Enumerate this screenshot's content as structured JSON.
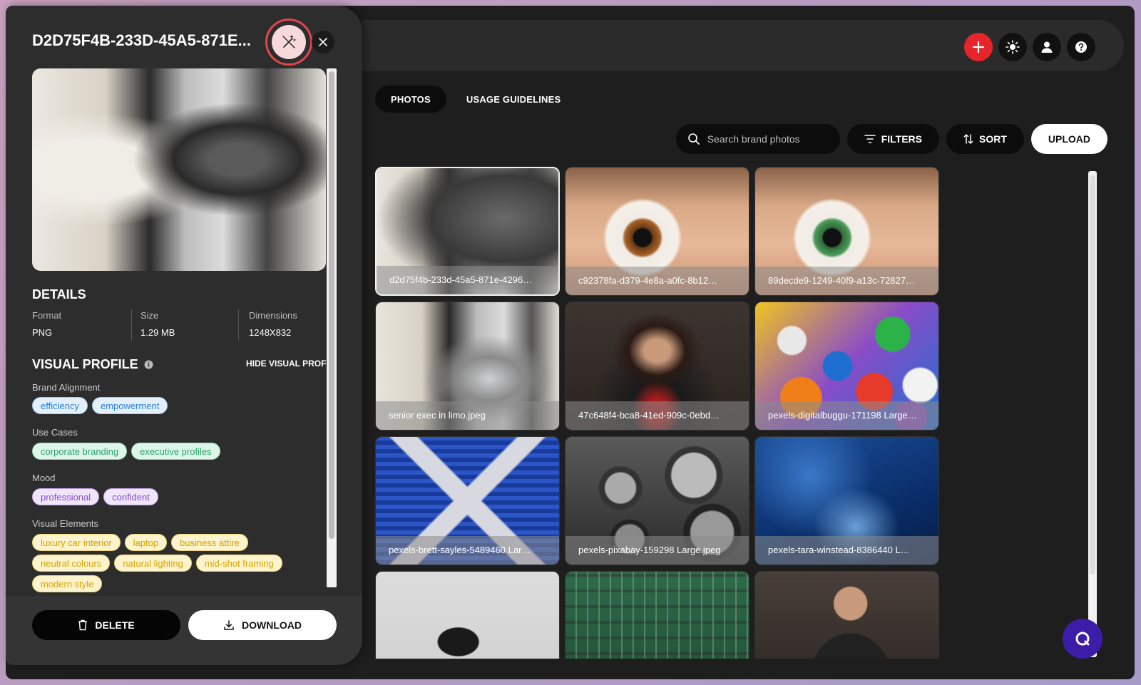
{
  "header": {
    "icons": [
      {
        "name": "add",
        "color": "#e5252a"
      },
      {
        "name": "theme-sun"
      },
      {
        "name": "user"
      },
      {
        "name": "help"
      }
    ]
  },
  "tabs": [
    {
      "label": "PHOTOS",
      "active": true
    },
    {
      "label": "USAGE GUIDELINES",
      "active": false
    }
  ],
  "toolbar": {
    "search_placeholder": "Search brand photos",
    "filters_label": "FILTERS",
    "sort_label": "SORT",
    "upload_label": "UPLOAD"
  },
  "photos": [
    {
      "name": "d2d75f4b-233d-45a5-871e-4296…",
      "selected": true
    },
    {
      "name": "c92378fa-d379-4e8a-a0fc-8b12…"
    },
    {
      "name": "89decde9-1249-40f9-a13c-72827…"
    },
    {
      "name": "senior exec in limo.jpeg"
    },
    {
      "name": "47c648f4-bca8-41ed-909c-0ebd…"
    },
    {
      "name": "pexels-digitalbuggu-171198 Large…"
    },
    {
      "name": "pexels-brett-sayles-5489460 Lar…"
    },
    {
      "name": "pexels-pixabay-159298 Large.jpeg"
    },
    {
      "name": "pexels-tara-winstead-8386440 L…"
    },
    {
      "name": ""
    },
    {
      "name": ""
    },
    {
      "name": ""
    }
  ],
  "panel": {
    "title": "D2D75F4B-233D-45A5-871E...",
    "details_heading": "DETAILS",
    "details": [
      {
        "label": "Format",
        "value": "PNG"
      },
      {
        "label": "Size",
        "value": "1.29 MB"
      },
      {
        "label": "Dimensions",
        "value": "1248X832"
      }
    ],
    "visual_profile_heading": "VISUAL PROFILE",
    "hide_visual_profile": "HIDE VISUAL PROFILE",
    "groups": [
      {
        "label": "Brand Alignment",
        "color": "blue",
        "tags": [
          "efficiency",
          "empowerment"
        ]
      },
      {
        "label": "Use Cases",
        "color": "green",
        "tags": [
          "corporate branding",
          "executive profiles"
        ]
      },
      {
        "label": "Mood",
        "color": "purple",
        "tags": [
          "professional",
          "confident"
        ]
      },
      {
        "label": "Visual Elements",
        "color": "yellow",
        "tags": [
          "luxury car interior",
          "laptop",
          "business attire",
          "neutral colours",
          "natural lighting",
          "mid-shot framing",
          "modern style"
        ]
      }
    ],
    "delete_label": "DELETE",
    "download_label": "DOWNLOAD"
  },
  "colors": {
    "accent_red": "#e5252a",
    "tag_blue": "#2b7fd6",
    "tag_green": "#28a466",
    "tag_purple": "#8a4dc7",
    "tag_yellow": "#d6a300",
    "fab": "#3b1da8"
  }
}
